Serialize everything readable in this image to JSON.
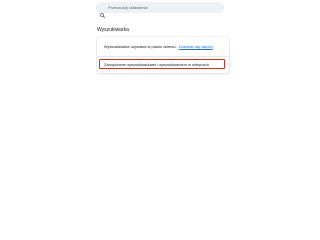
{
  "search": {
    "placeholder": "Przeszukaj ustawienia"
  },
  "section": {
    "title": "Wyszukiwarka"
  },
  "settings": {
    "address_bar_engine_text": "Wyszukiwarka używana w pasku adresu.",
    "address_bar_engine_link": "Dowiedz się więcej",
    "manage_engines_label": "Zarządzanie wyszukiwarkami i wyszukiwaniem w witrynach"
  },
  "colors": {
    "highlight_border": "#d93025",
    "link": "#1a73e8"
  }
}
